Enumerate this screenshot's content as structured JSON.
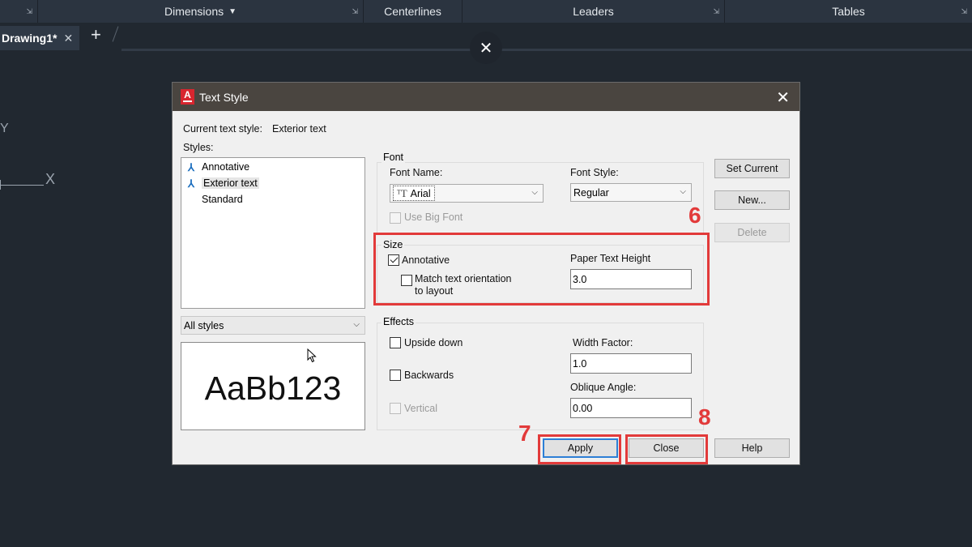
{
  "ribbon": {
    "panels": [
      {
        "label": "",
        "has_dropdown": false
      },
      {
        "label": "Dimensions",
        "has_dropdown": true
      },
      {
        "label": "Centerlines",
        "has_dropdown": false
      },
      {
        "label": "Leaders",
        "has_dropdown": false
      },
      {
        "label": "Tables",
        "has_dropdown": false
      }
    ]
  },
  "tabs": {
    "active": "Drawing1*",
    "close_glyph": "✕",
    "add_glyph": "+"
  },
  "overlay_close_glyph": "✕",
  "ucs": {
    "y_label": "Y",
    "x_label": "X"
  },
  "dialog": {
    "title": "Text Style",
    "close_glyph": "✕",
    "current_style_label": "Current text style:",
    "current_style_value": "Exterior text",
    "styles_label": "Styles:",
    "styles": [
      {
        "name": "Annotative",
        "annotative": true,
        "selected": false
      },
      {
        "name": "Exterior text",
        "annotative": true,
        "selected": true
      },
      {
        "name": "Standard",
        "annotative": false,
        "selected": false
      }
    ],
    "filter_value": "All styles",
    "preview_text": "AaBb123",
    "font": {
      "group_label": "Font",
      "name_label": "Font Name:",
      "name_value": "Arial",
      "style_label": "Font Style:",
      "style_value": "Regular",
      "big_font_label": "Use Big Font"
    },
    "size": {
      "group_label": "Size",
      "annotative_label": "Annotative",
      "annotative_checked": true,
      "match_label_1": "Match text orientation",
      "match_label_2": "to layout",
      "height_label": "Paper Text Height",
      "height_value": "3.0"
    },
    "effects": {
      "group_label": "Effects",
      "upside_down_label": "Upside down",
      "backwards_label": "Backwards",
      "vertical_label": "Vertical",
      "width_label": "Width Factor:",
      "width_value": "1.0",
      "oblique_label": "Oblique Angle:",
      "oblique_value": "0.00"
    },
    "buttons": {
      "set_current": "Set Current",
      "new": "New...",
      "delete": "Delete",
      "apply": "Apply",
      "close": "Close",
      "help": "Help"
    }
  },
  "annotations": {
    "step6": "6",
    "step7": "7",
    "step8": "8"
  },
  "colors": {
    "annotation_red": "#e23a3a",
    "titlebar": "#4a4540",
    "canvas": "#212830"
  }
}
